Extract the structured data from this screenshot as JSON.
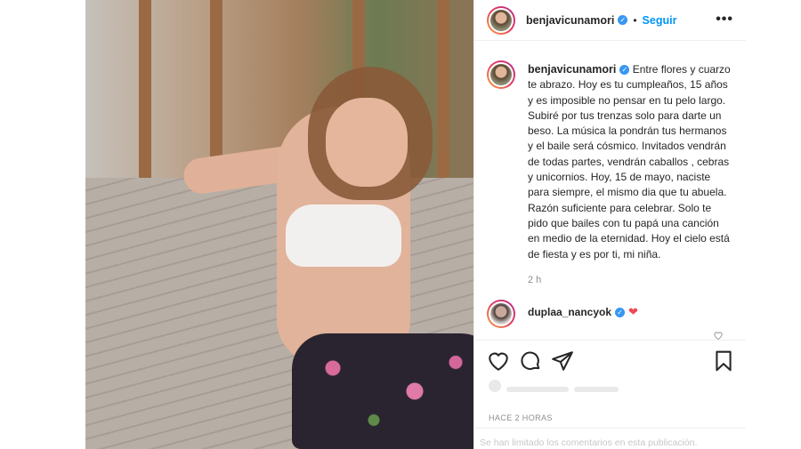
{
  "post": {
    "username": "benjavicunamori",
    "follow_label": "Seguir",
    "separator": "•",
    "more_label": "•••",
    "caption": "Entre flores y cuarzo te abrazo. Hoy es tu cumpleaños, 15 años y es imposible no pensar en tu pelo largo. Subiré por tus trenzas solo para darte un beso. La música la pondrán tus hermanos y el baile será cósmico. Invitados vendrán de todas partes, vendrán caballos , cebras y unicornios. Hoy, 15 de mayo, naciste para siempre, el mismo dia que tu abuela. Razón suficiente para celebrar. Solo te pido que bailes con tu papá una canción en medio de la eternidad. Hoy el cielo está de fiesta y es por ti, mi niña.",
    "caption_time": "2 h",
    "time_ago": "HACE 2 HORAS",
    "comments_limited": "Se han limitado los comentarios en esta publicación."
  },
  "comment": {
    "username": "duplaa_nancyok",
    "heart": "❤"
  },
  "icons": {
    "verified": "verified-badge-icon",
    "like": "heart-outline-icon",
    "comment": "comment-bubble-icon",
    "share": "paper-plane-icon",
    "save": "bookmark-icon"
  },
  "colors": {
    "follow_blue": "#0095f6",
    "verified_blue": "#3897f0",
    "heart_red": "#ed4956",
    "muted": "#8e8e8e"
  }
}
